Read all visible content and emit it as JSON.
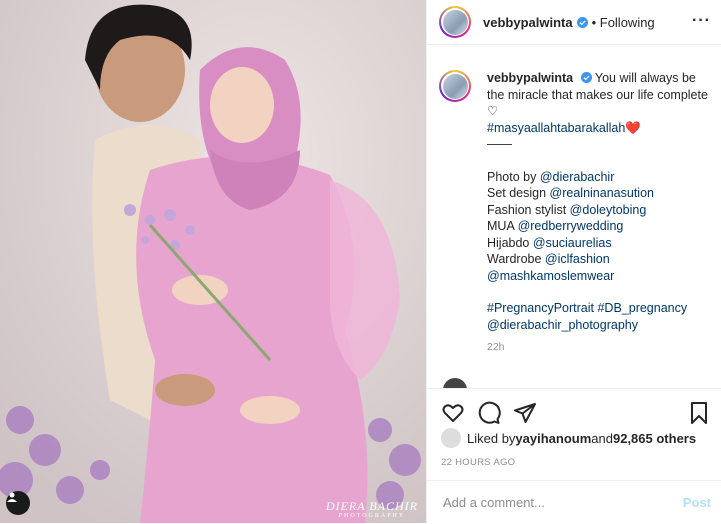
{
  "post": {
    "username": "vebbypalwinta",
    "following": "Following",
    "more_icon": "more-icon"
  },
  "caption": {
    "username": "vebbypalwinta",
    "text": "You will always be the miracle that makes our life complete ♡",
    "hashtag": "#masyaallahtabarakallah",
    "heart": "❤️",
    "separator": "——",
    "lines": [
      {
        "label": "Photo by ",
        "link": "@dierabachir"
      },
      {
        "label": "Set design ",
        "link": "@realninanasution"
      },
      {
        "label": "Fashion stylist ",
        "link": "@doleytobing"
      },
      {
        "label": "MUA ",
        "link": "@redberrywedding"
      },
      {
        "label": "Hijabdo ",
        "link": "@suciaurelias"
      },
      {
        "label": "Wardrobe ",
        "link": "@iclfashion"
      },
      {
        "label": "",
        "link": "@mashkamoslemwear"
      }
    ],
    "tags_line1": "#PregnancyPortrait #DB_pregnancy",
    "tags_line2": "@dierabachir_photography",
    "time": "22h"
  },
  "likes": {
    "prefix": "Liked by ",
    "user": "yayihanoum",
    "and": " and ",
    "count": "92,865 others"
  },
  "timestamp": "22 HOURS AGO",
  "comment": {
    "placeholder": "Add a comment...",
    "post_label": "Post"
  },
  "watermark": {
    "name": "DIERA BACHIR",
    "sub": "PHOTOGRAPHY"
  }
}
